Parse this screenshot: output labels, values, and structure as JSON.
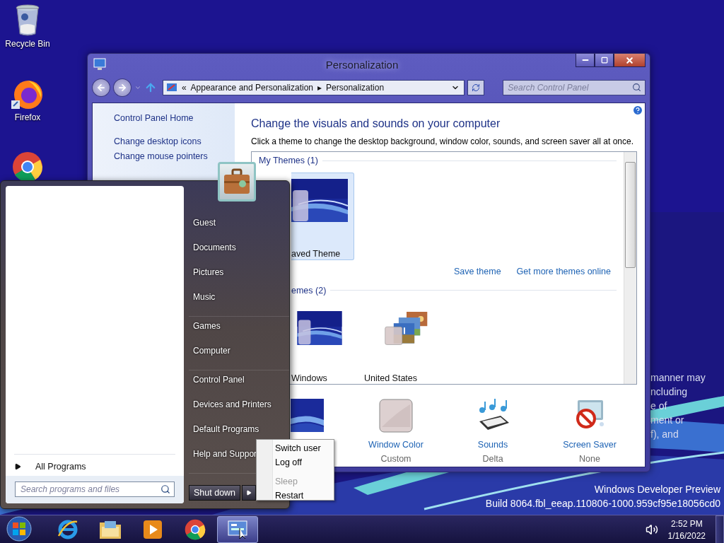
{
  "desktop": {
    "icons": [
      {
        "kind": "recycle",
        "label": "Recycle Bin"
      },
      {
        "kind": "firefox",
        "label": "Firefox"
      },
      {
        "kind": "chrome"
      }
    ],
    "background_text": [
      "manner may",
      "ncluding",
      "e of",
      "ment or",
      "f), and"
    ],
    "build_info": [
      "Windows Developer Preview",
      "Build 8064.fbl_eeap.110806-1000.959cf95e18056cd0"
    ]
  },
  "window": {
    "title": "Personalization",
    "address": {
      "chevron": "«",
      "crumbs": [
        "Appearance and Personalization",
        "Personalization"
      ],
      "separator": "▸"
    },
    "search": {
      "placeholder": "Search Control Panel"
    },
    "left_pane": [
      "Control Panel Home",
      "Change desktop icons",
      "Change mouse pointers"
    ],
    "heading": "Change the visuals and sounds on your computer",
    "description": "Click a theme to change the desktop background, window color, sounds, and screen saver all at once.",
    "theme_groups": [
      {
        "title": "My Themes (1)",
        "themes": [
          {
            "kind": "wave",
            "label": "aved Theme",
            "selected": true
          }
        ]
      },
      {
        "title": "emes (2)",
        "themes": [
          {
            "kind": "wave",
            "label": "Windows",
            "selected": false
          },
          {
            "kind": "photos",
            "label": "United States",
            "selected": false
          }
        ]
      }
    ],
    "links": [
      "Save theme",
      "Get more themes online"
    ],
    "settings": [
      {
        "kind": "background"
      },
      {
        "kind": "color",
        "label": "Window Color",
        "value": "Custom"
      },
      {
        "kind": "sounds",
        "label": "Sounds",
        "value": "Delta"
      },
      {
        "kind": "screensaver",
        "label": "Screen Saver",
        "value": "None"
      }
    ]
  },
  "start_menu": {
    "places": [
      [
        "Guest",
        "Documents",
        "Pictures",
        "Music"
      ],
      [
        "Games",
        "Computer"
      ],
      [
        "Control Panel",
        "Devices and Printers",
        "Default Programs",
        "Help and Suppor"
      ]
    ],
    "all_programs": "All Programs",
    "search": {
      "placeholder": "Search programs and files"
    },
    "shutdown": "Shut down",
    "power_menu": [
      [
        {
          "label": "Switch user",
          "disabled": false
        },
        {
          "label": "Log off",
          "disabled": false
        }
      ],
      [
        {
          "label": "Sleep",
          "disabled": true
        },
        {
          "label": "Restart",
          "disabled": false
        }
      ]
    ]
  },
  "taskbar": {
    "apps": [
      {
        "kind": "ie",
        "selected": false
      },
      {
        "kind": "explorer",
        "selected": false
      },
      {
        "kind": "media",
        "selected": false
      },
      {
        "kind": "chrome",
        "selected": false
      },
      {
        "kind": "control",
        "selected": true
      }
    ],
    "clock": {
      "time": "2:52 PM",
      "date": "1/16/2022"
    }
  }
}
